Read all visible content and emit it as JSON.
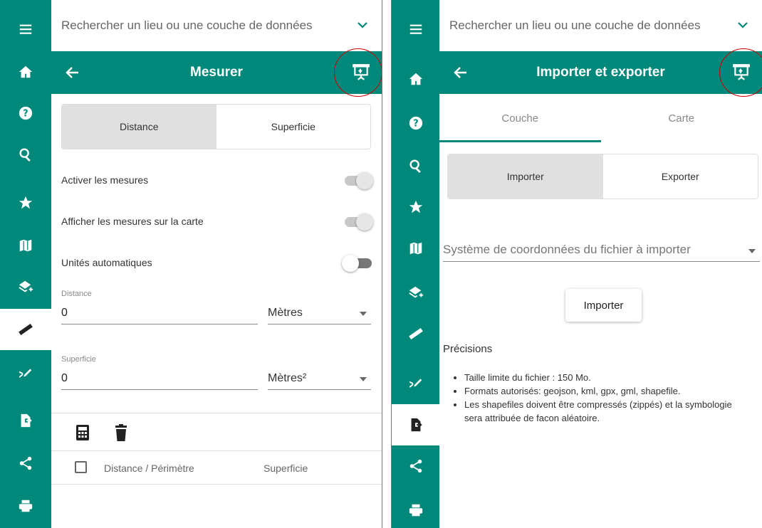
{
  "left_panel": {
    "search_placeholder": "Rechercher un lieu ou une couche de données",
    "title": "Mesurer",
    "mode_tabs": [
      "Distance",
      "Superficie"
    ],
    "toggles": [
      {
        "label": "Activer les mesures",
        "on": true
      },
      {
        "label": "Afficher les mesures sur la carte",
        "on": true
      },
      {
        "label": "Unités automatiques",
        "on": false
      }
    ],
    "distance": {
      "caption": "Distance",
      "value": "0",
      "unit": "Mètres"
    },
    "area": {
      "caption": "Superficie",
      "value": "0",
      "unit": "Mètres²"
    },
    "table_headers": [
      "Distance / Périmètre",
      "Superficie"
    ],
    "active_sidebar": "measure"
  },
  "right_panel": {
    "search_placeholder": "Rechercher un lieu ou une couche de données",
    "title": "Importer et exporter",
    "tabs": [
      "Couche",
      "Carte"
    ],
    "mode_tabs": [
      "Importer",
      "Exporter"
    ],
    "crs_placeholder": "Système de coordonnées du fichier à importer",
    "import_button": "Importer",
    "details_heading": "Précisions",
    "details": [
      "Taille limite du fichier : 150 Mo.",
      "Formats autorisés: geojson, kml, gpx, gml, shapefile.",
      "Les shapefiles doivent être compressés (zippés) et la symbologie sera attribuée de facon aléatoire."
    ],
    "active_sidebar": "import-export"
  },
  "sidebar_icons": [
    "menu-icon",
    "home-icon",
    "help-icon",
    "search-icon",
    "star-icon",
    "map-icon",
    "add-layer-icon",
    "ruler-icon",
    "draw-icon",
    "import-export-icon",
    "share-icon",
    "print-icon"
  ],
  "colors": {
    "primary": "#00897b",
    "highlight_ring": "#cc0000"
  }
}
